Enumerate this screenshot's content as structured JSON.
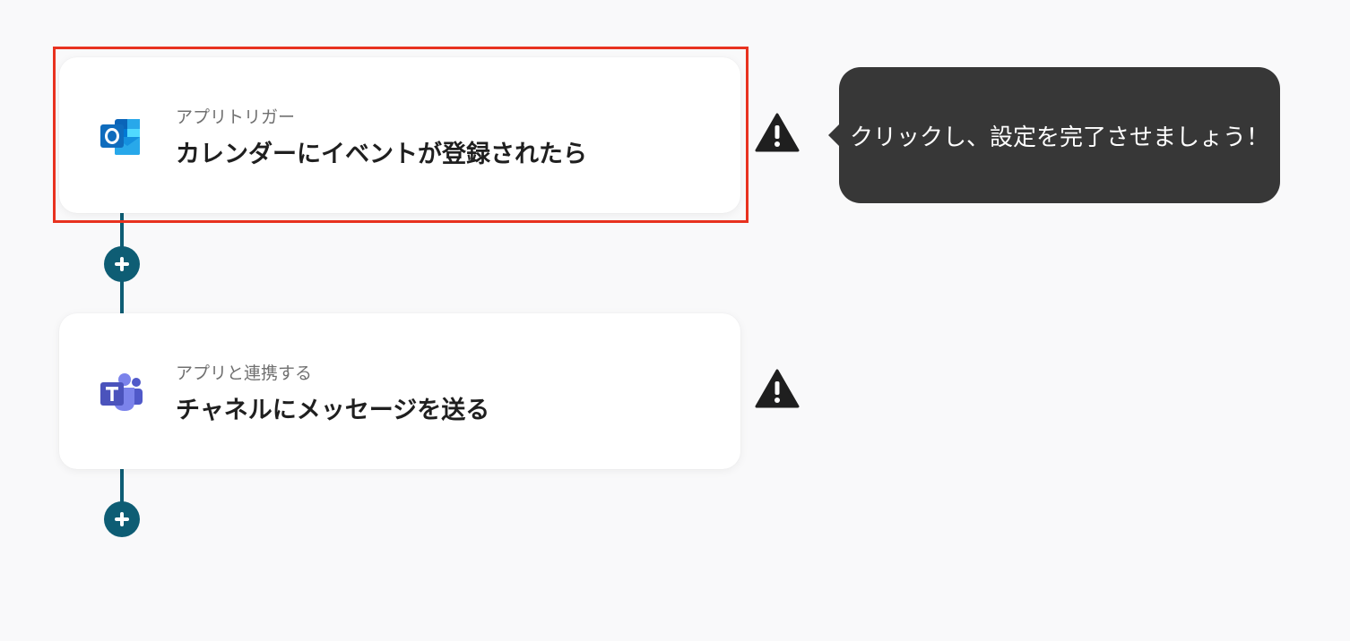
{
  "flow": {
    "steps": [
      {
        "app": "outlook",
        "icon": "outlook-icon",
        "subtitle": "アプリトリガー",
        "title": "カレンダーにイベントが登録されたら",
        "warning_icon": "warning-icon",
        "highlighted": true
      },
      {
        "app": "teams",
        "icon": "teams-icon",
        "subtitle": "アプリと連携する",
        "title": "チャネルにメッセージを送る",
        "warning_icon": "warning-icon",
        "highlighted": false
      }
    ],
    "add_icon": "plus-icon"
  },
  "tooltip": {
    "text": "クリックし、設定を完了させましょう！"
  },
  "colors": {
    "background": "#f9f9fa",
    "connector": "#0e5d74",
    "highlight": "#e8321f",
    "tooltip_bg": "#373737",
    "warning": "#1f1f1f"
  }
}
